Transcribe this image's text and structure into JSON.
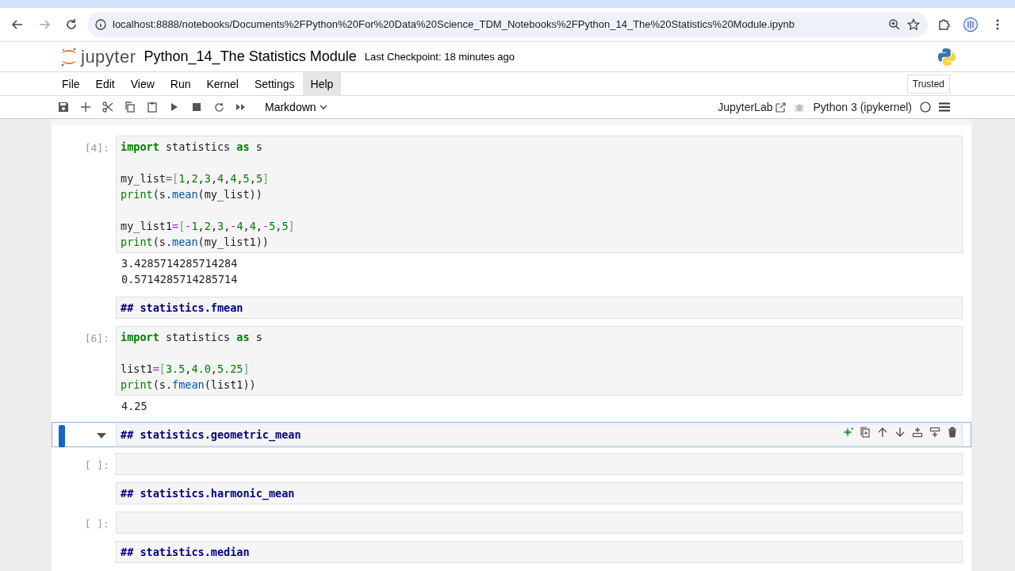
{
  "browser": {
    "url": "localhost:8888/notebooks/Documents%2FPython%20For%20Data%20Science_TDM_Notebooks%2FPython_14_The%20Statistics%20Module.ipynb"
  },
  "header": {
    "logo_text": "jupyter",
    "title": "Python_14_The Statistics Module",
    "checkpoint": "Last Checkpoint: 18 minutes ago"
  },
  "menu": [
    {
      "label": "File",
      "selected": false
    },
    {
      "label": "Edit",
      "selected": false
    },
    {
      "label": "View",
      "selected": false
    },
    {
      "label": "Run",
      "selected": false
    },
    {
      "label": "Kernel",
      "selected": false
    },
    {
      "label": "Settings",
      "selected": false
    },
    {
      "label": "Help",
      "selected": true
    }
  ],
  "trusted": "Trusted",
  "toolbar": {
    "cell_type": "Markdown",
    "jupyterlab": "JupyterLab",
    "kernel": "Python 3 (ipykernel)"
  },
  "cells": [
    {
      "kind": "code",
      "prompt": "[4]:",
      "selected": false,
      "lines": [
        {
          "kind": "code",
          "tokens": [
            {
              "text": "import",
              "kind": "keyword"
            },
            {
              "text": " statistics ",
              "kind": "name"
            },
            {
              "text": "as",
              "kind": "keyword"
            },
            {
              "text": " s",
              "kind": "name"
            }
          ]
        },
        {
          "kind": "blank"
        },
        {
          "kind": "code",
          "tokens": [
            {
              "text": "my_list",
              "kind": "name"
            },
            {
              "text": "=",
              "kind": "operator"
            },
            {
              "text": "[",
              "kind": "bracket"
            },
            {
              "text": "1",
              "kind": "number"
            },
            {
              "text": ",",
              "kind": "name"
            },
            {
              "text": "2",
              "kind": "number"
            },
            {
              "text": ",",
              "kind": "name"
            },
            {
              "text": "3",
              "kind": "number"
            },
            {
              "text": ",",
              "kind": "name"
            },
            {
              "text": "4",
              "kind": "number"
            },
            {
              "text": ",",
              "kind": "name"
            },
            {
              "text": "4",
              "kind": "number"
            },
            {
              "text": ",",
              "kind": "name"
            },
            {
              "text": "5",
              "kind": "number"
            },
            {
              "text": ",",
              "kind": "name"
            },
            {
              "text": "5",
              "kind": "number"
            },
            {
              "text": "]",
              "kind": "bracket"
            }
          ]
        },
        {
          "kind": "code",
          "tokens": [
            {
              "text": "print",
              "kind": "builtin"
            },
            {
              "text": "(s.",
              "kind": "name"
            },
            {
              "text": "mean",
              "kind": "attribute"
            },
            {
              "text": "(my_list))",
              "kind": "name"
            }
          ]
        },
        {
          "kind": "blank"
        },
        {
          "kind": "code",
          "tokens": [
            {
              "text": "my_list1",
              "kind": "name"
            },
            {
              "text": "=",
              "kind": "operator"
            },
            {
              "text": "[",
              "kind": "bracket"
            },
            {
              "text": "-",
              "kind": "operator"
            },
            {
              "text": "1",
              "kind": "number"
            },
            {
              "text": ",",
              "kind": "name"
            },
            {
              "text": "2",
              "kind": "number"
            },
            {
              "text": ",",
              "kind": "name"
            },
            {
              "text": "3",
              "kind": "number"
            },
            {
              "text": ",",
              "kind": "name"
            },
            {
              "text": "-",
              "kind": "operator"
            },
            {
              "text": "4",
              "kind": "number"
            },
            {
              "text": ",",
              "kind": "name"
            },
            {
              "text": "4",
              "kind": "number"
            },
            {
              "text": ",",
              "kind": "name"
            },
            {
              "text": "-",
              "kind": "operator"
            },
            {
              "text": "5",
              "kind": "number"
            },
            {
              "text": ",",
              "kind": "name"
            },
            {
              "text": "5",
              "kind": "number"
            },
            {
              "text": "]",
              "kind": "bracket"
            }
          ]
        },
        {
          "kind": "code",
          "tokens": [
            {
              "text": "print",
              "kind": "builtin"
            },
            {
              "text": "(s.",
              "kind": "name"
            },
            {
              "text": "mean",
              "kind": "attribute"
            },
            {
              "text": "(my_list1))",
              "kind": "name"
            }
          ]
        }
      ],
      "outputs": [
        "3.4285714285714284",
        "0.5714285714285714"
      ]
    },
    {
      "kind": "markdown",
      "text": "## statistics.fmean",
      "selected": false
    },
    {
      "kind": "code",
      "prompt": "[6]:",
      "selected": false,
      "lines": [
        {
          "kind": "code",
          "tokens": [
            {
              "text": "import",
              "kind": "keyword"
            },
            {
              "text": " statistics ",
              "kind": "name"
            },
            {
              "text": "as",
              "kind": "keyword"
            },
            {
              "text": " s",
              "kind": "name"
            }
          ]
        },
        {
          "kind": "blank"
        },
        {
          "kind": "code",
          "tokens": [
            {
              "text": "list1",
              "kind": "name"
            },
            {
              "text": "=",
              "kind": "operator"
            },
            {
              "text": "[",
              "kind": "bracket"
            },
            {
              "text": "3.5",
              "kind": "number"
            },
            {
              "text": ",",
              "kind": "name"
            },
            {
              "text": "4.0",
              "kind": "number"
            },
            {
              "text": ",",
              "kind": "name"
            },
            {
              "text": "5.25",
              "kind": "number"
            },
            {
              "text": "]",
              "kind": "bracket"
            }
          ]
        },
        {
          "kind": "code",
          "tokens": [
            {
              "text": "print",
              "kind": "builtin"
            },
            {
              "text": "(s.",
              "kind": "name"
            },
            {
              "text": "fmean",
              "kind": "attribute"
            },
            {
              "text": "(list1))",
              "kind": "name"
            }
          ]
        }
      ],
      "outputs": [
        "4.25"
      ]
    },
    {
      "kind": "markdown",
      "text": "## statistics.geometric_mean",
      "selected": true
    },
    {
      "kind": "code",
      "prompt": "[ ]:",
      "selected": false
    },
    {
      "kind": "markdown",
      "text": "## statistics.harmonic_mean",
      "selected": false
    },
    {
      "kind": "code",
      "prompt": "[ ]:",
      "selected": false
    },
    {
      "kind": "markdown",
      "text": "## statistics.median",
      "selected": false
    }
  ]
}
